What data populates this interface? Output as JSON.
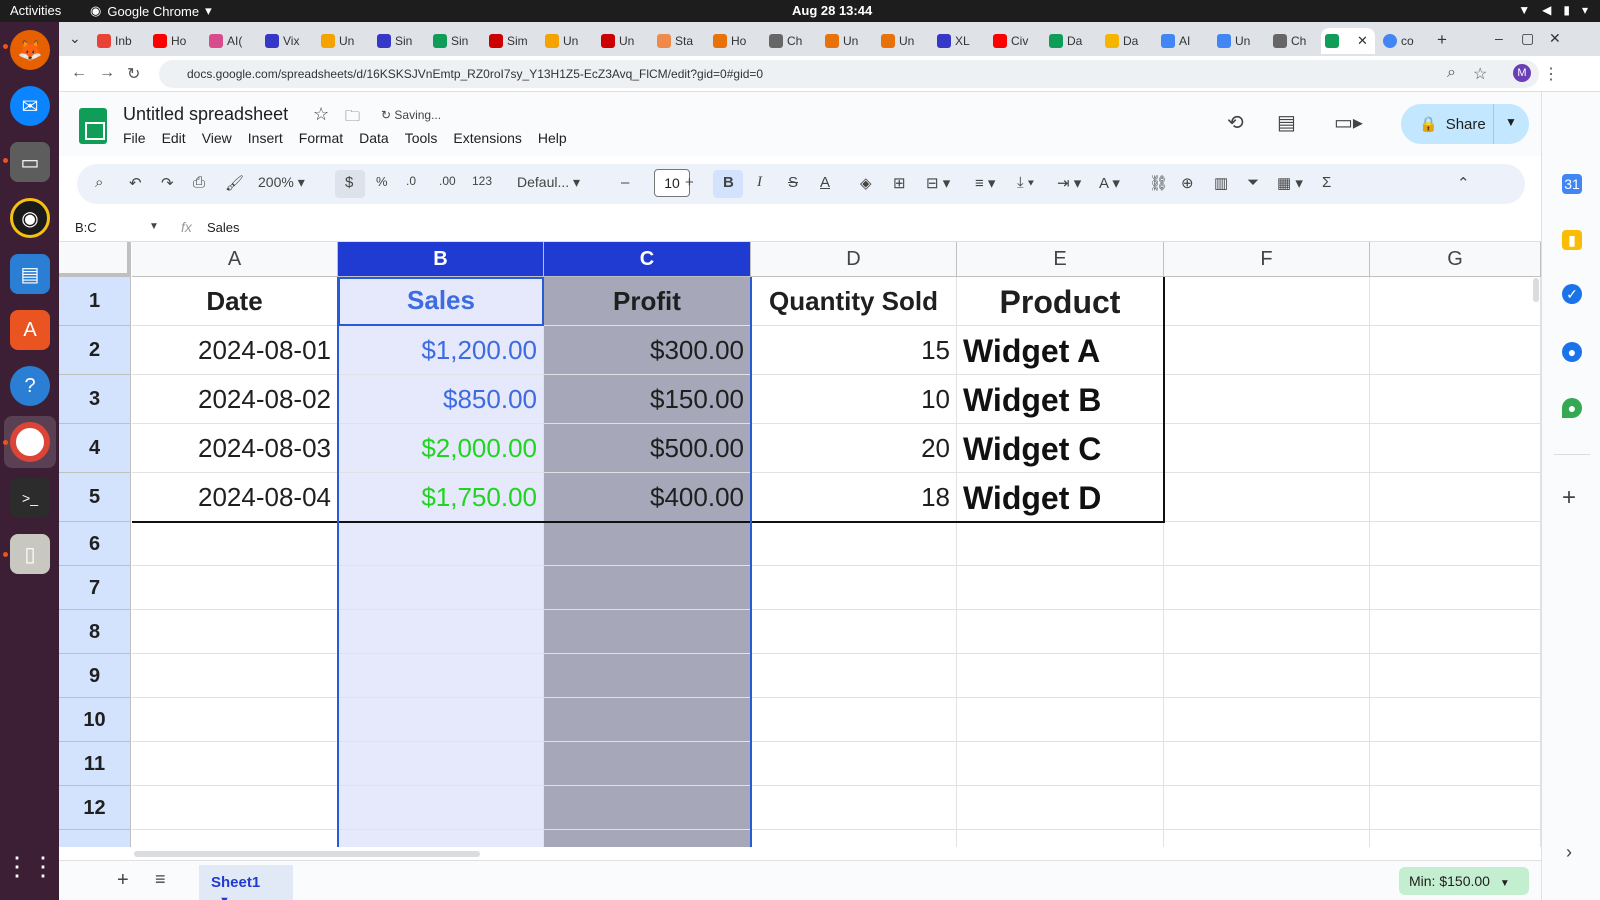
{
  "os": {
    "activities": "Activities",
    "app_menu": "Google Chrome",
    "clock": "Aug 28  13:44"
  },
  "browser": {
    "tabs": [
      "Inb",
      "Ho",
      "AI(",
      "Vix",
      "Un",
      "Sin",
      "Sin",
      "Sim",
      "Un",
      "Un",
      "Sta",
      "Ho",
      "Ch",
      "Un",
      "Un",
      "XL",
      "Civ",
      "Da",
      "Da",
      "AI",
      "Un",
      "Ch",
      "",
      "co"
    ],
    "url": "docs.google.com/spreadsheets/d/16KSKSJVnEmtp_RZ0roI7sy_Y13H1Z5-EcZ3Avq_FlCM/edit?gid=0#gid=0",
    "profile_initial": "M"
  },
  "doc": {
    "title": "Untitled spreadsheet",
    "status": "Saving...",
    "menu": [
      "File",
      "Edit",
      "View",
      "Insert",
      "Format",
      "Data",
      "Tools",
      "Extensions",
      "Help"
    ],
    "share_label": "Share",
    "avatar_initial": "M"
  },
  "toolbar": {
    "zoom": "200%",
    "currency": "$",
    "percent": "%",
    "dec_decrease": ".0",
    "dec_increase": ".00",
    "number_format": "123",
    "font": "Defaul...",
    "font_size": "10"
  },
  "formula_bar": {
    "name_box": "B:C",
    "fx": "fx",
    "content": "Sales"
  },
  "grid": {
    "columns": [
      "A",
      "B",
      "C",
      "D",
      "E",
      "F",
      "G"
    ],
    "selected_columns": [
      "B",
      "C"
    ],
    "rows": [
      "1",
      "2",
      "3",
      "4",
      "5",
      "6",
      "7",
      "8",
      "9",
      "10",
      "11",
      "12"
    ],
    "headers": {
      "date": "Date",
      "sales": "Sales",
      "profit": "Profit",
      "quantity": "Quantity Sold",
      "product": "Product"
    },
    "data": [
      {
        "date": "2024-08-01",
        "sales": "$1,200.00",
        "profit": "$300.00",
        "quantity": "15",
        "product": "Widget A"
      },
      {
        "date": "2024-08-02",
        "sales": "$850.00",
        "profit": "$150.00",
        "quantity": "10",
        "product": "Widget B"
      },
      {
        "date": "2024-08-03",
        "sales": "$2,000.00",
        "profit": "$500.00",
        "quantity": "20",
        "product": "Widget C"
      },
      {
        "date": "2024-08-04",
        "sales": "$1,750.00",
        "profit": "$400.00",
        "quantity": "18",
        "product": "Widget D"
      }
    ]
  },
  "bottom": {
    "sheet_name": "Sheet1",
    "stat": "Min: $150.00"
  },
  "colors": {
    "selected_header": "#1f3bd1",
    "sales_blue": "#3d6be0",
    "sales_green": "#21d421",
    "profit_fill": "#a6a7b8",
    "share_bg": "#c2e7ff"
  }
}
